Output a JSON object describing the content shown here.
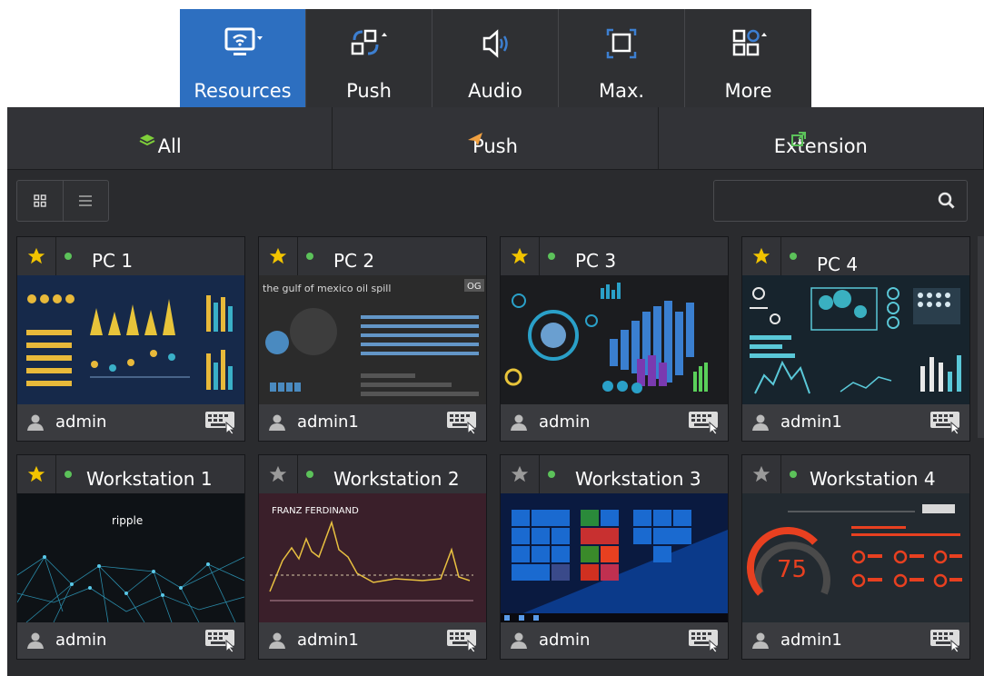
{
  "toolbar": {
    "items": [
      {
        "label": "Resources",
        "icon": "monitor-wifi-icon",
        "active": true
      },
      {
        "label": "Push",
        "icon": "push-arrows-icon",
        "active": false
      },
      {
        "label": "Audio",
        "icon": "speaker-icon",
        "active": false
      },
      {
        "label": "Max.",
        "icon": "maximize-icon",
        "active": false
      },
      {
        "label": "More",
        "icon": "grid-more-icon",
        "active": false
      }
    ]
  },
  "tabs": [
    {
      "label": "All",
      "icon": "layers-icon"
    },
    {
      "label": "Push",
      "icon": "paper-plane-icon"
    },
    {
      "label": "Extension",
      "icon": "external-window-icon"
    }
  ],
  "search": {
    "placeholder": "",
    "icon": "search-icon"
  },
  "cards": [
    {
      "title": "PC 1",
      "user": "admin",
      "starred": true,
      "thumb": "infographic-yellow"
    },
    {
      "title": "PC 2",
      "user": "admin1",
      "starred": true,
      "thumb": "gulf-oil-spill"
    },
    {
      "title": "PC 3",
      "user": "admin",
      "starred": true,
      "thumb": "3d-bars"
    },
    {
      "title": "PC 4",
      "user": "admin1",
      "starred": true,
      "thumb": "dashboard-teal"
    },
    {
      "title": "Workstation 1",
      "user": "admin",
      "starred": true,
      "thumb": "ripple"
    },
    {
      "title": "Workstation 2",
      "user": "admin1",
      "starred": false,
      "thumb": "line-chart"
    },
    {
      "title": "Workstation 3",
      "user": "admin",
      "starred": false,
      "thumb": "windows-desktop"
    },
    {
      "title": "Workstation 4",
      "user": "admin1",
      "starred": false,
      "thumb": "gauge-dashboard"
    }
  ],
  "thumb_text": {
    "pc2_title": "the gulf of mexico oil spill",
    "pc2_badge": "OG",
    "ws1_logo": "ripple",
    "ws2_title": "FRANZ FERDINAND",
    "ws4_value": "75"
  },
  "colors": {
    "accent_blue": "#2d6fc0",
    "star_gold": "#f2c400",
    "star_grey": "#9a9a9a",
    "status_green": "#5cc25a",
    "panel_bg": "#2a2b2e"
  }
}
